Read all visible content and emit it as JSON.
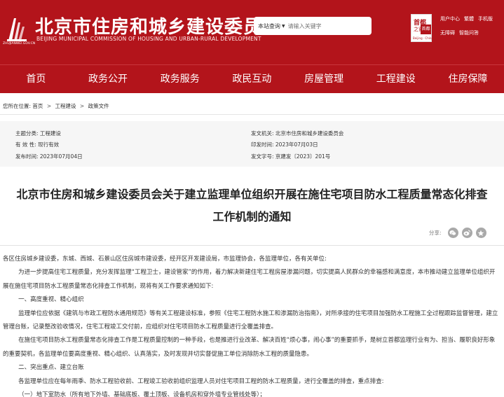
{
  "header": {
    "logo_caption": "ZHUJIANWEI.GOV.CN",
    "title": "北京市住房和城乡建设委员会",
    "subtitle": "BEIJING MUNICIPAL COMMISSION OF HOUSING AND URBAN-RURAL DEVELOPMENT",
    "search_scope": "本站查询",
    "search_placeholder": "请输入关键字",
    "badge_top": "首都",
    "badge_left": "之窗",
    "badge_mid": "首都",
    "badge_bottom": "Beijing · China",
    "links_row1": [
      "用户中心",
      "繁體",
      "手机版"
    ],
    "links_row2": [
      "无障碍",
      "智能问答"
    ],
    "brand_color": "#b3141b"
  },
  "nav": [
    "首页",
    "政务公开",
    "政务服务",
    "政民互动",
    "房屋管理",
    "工程建设",
    "住房保障"
  ],
  "breadcrumb": {
    "prefix": "您所在位置:",
    "items": [
      "首页",
      "工程建设",
      "政策文件"
    ],
    "separator": ">"
  },
  "meta": {
    "category": "主题分类:  工程建设",
    "validity": "有 效 性:  现行有效",
    "publish_date": "发布时间:  2023年07月04日",
    "issuer": "发文机关:  北京市住房和城乡建设委员会",
    "print_date": "印发时间:  2023年07月03日",
    "doc_number": "发文字号:  京建发〔2023〕201号"
  },
  "title_line1": "北京市住房和城乡建设委员会关于建立监理单位组织开展在施住宅项目防水工程质量常态化排查",
  "title_line2": "工作机制的通知",
  "share_label": "分享:",
  "body": [
    "各区住房城乡建设委，东城、西城、石景山区住房城市建设委，经开区开发建设局，市监理协会，各监理单位，各有关单位:",
    "为进一步提高住宅工程质量，充分发挥监理“工程卫士，建设管家”的作用，着力解决新建住宅工程房屋渗漏问题，切实提高人民群众的幸福感和满意度，本市推动建立监理单位组织开展在施住宅项目防水工程质量常态化排查工作机制，现将有关工作要求通知如下:",
    "一、高度重视、精心组织",
    "监理单位应依据《建筑与市政工程防水通用规范》等有关工程建设标准，参照《住宅工程防水施工和渗漏防治指南》，对所承接的住宅项目加强防水工程施工全过程跟踪监督管理，建立管理台账，记录整改验收情况，住宅工程竣工交付前，应组织对住宅项目防水工程质量进行全覆盖排查。",
    "在施住宅项目防水工程质量常态化排查工作是工程质量控制的一种手段，也是推进行业改革、解决百姓“烦心事，闹心事”的重要抓手，是树立首都监理行业有为、担当、履职良好形象的重要契机，各监理单位要高度重视、精心组织、认真落实，及时发现并切实督促施工单位消除防水工程的质量隐患。",
    "二、突出重点、建立台账",
    "各监理单位应在每年雨季、防水工程验收前、工程竣工验收前组织监理人员对住宅项目工程的防水工程质量，进行全覆盖的排查，重点排查:",
    "（一）地下室防水（所有地下外墙、基础底板、覆土顶板、设备机房和穿外墙专业管线处等）；"
  ]
}
